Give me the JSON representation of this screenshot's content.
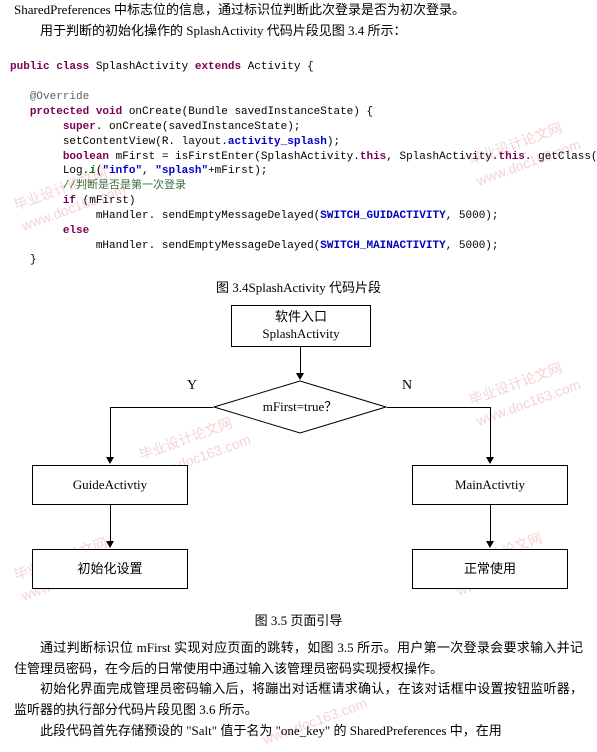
{
  "intro": {
    "line1": "SharedPreferences 中标志位的信息，通过标识位判断此次登录是否为初次登录。",
    "line2": "用于判断的初始化操作的 SplashActivity 代码片段见图 3.4 所示："
  },
  "code": {
    "l1_kw1": "public class",
    "l1_cls": "SplashActivity",
    "l1_kw2": "extends",
    "l1_sup": "Activity {",
    "l2_anno": "@Override",
    "l3_kw": "protected void",
    "l3_m": " onCreate(Bundle savedInstanceState) {",
    "l4_kw": "super",
    "l4_r": ". onCreate(savedInstanceState);",
    "l5_a": "setContentView(R. layout.",
    "l5_b": "activity_splash",
    "l5_c": ");",
    "l6_kw": "boolean",
    "l6_a": " mFirst = isFirstEnter(SplashActivity.",
    "l6_kw2": "this",
    "l6_b": ", SplashActivity.",
    "l6_kw3": "this",
    "l6_c": ". getClass(). getName());",
    "l7_a": "Log.",
    "l7_m": "i",
    "l7_p1": "(",
    "l7_s1": "\"info\"",
    "l7_c1": ", ",
    "l7_s2": "\"splash\"",
    "l7_c2": "+mFirst);",
    "l8_cmt": "//判断是否是第一次登录",
    "l9_kw": "if",
    "l9_r": " (mFirst)",
    "l10_a": "mHandler. sendEmptyMessageDelayed(",
    "l10_b": "SWITCH_GUIDACTIVITY",
    "l10_c": ", 5000);",
    "l11_kw": "else",
    "l12_a": "mHandler. sendEmptyMessageDelayed(",
    "l12_b": "SWITCH_MAINACTIVITY",
    "l12_c": ", 5000);",
    "l13": "}"
  },
  "caption1": "图 3.4SplashActivity 代码片段",
  "flow": {
    "entry1": "软件入口",
    "entry2": "SplashActivity",
    "cond": "mFirst=true？",
    "y": "Y",
    "n": "N",
    "guide": "GuideActivtiy",
    "main": "MainActivtiy",
    "init": "初始化设置",
    "normal": "正常使用"
  },
  "caption2": "图 3.5 页面引导",
  "outro": {
    "p1": "通过判断标识位 mFirst 实现对应页面的跳转，如图 3.5 所示。用户第一次登录会要求输入并记住管理员密码，在今后的日常使用中通过输入该管理员密码实现授权操作。",
    "p2": "初始化界面完成管理员密码输入后，将蹦出对话框请求确认，在该对话框中设置按钮监听器，监听器的执行部分代码片段见图 3.6 所示。",
    "p3": "此段代码首先存储预设的 \"Salt\" 值于名为 \"one_key\" 的 SharedPreferences 中，在用"
  },
  "watermark": {
    "cn": "毕业设计论文网",
    "en": "www.doc163.com"
  }
}
